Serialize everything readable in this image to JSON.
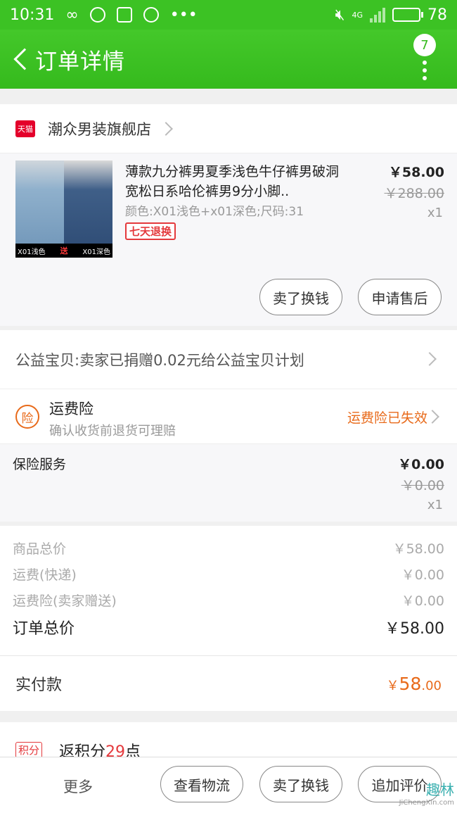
{
  "status_bar": {
    "time": "10:31",
    "network": "4G",
    "battery": "78",
    "battery_level": 0.78
  },
  "header": {
    "title": "订单详情",
    "menu_badge": "7"
  },
  "shop": {
    "badge": "天猫",
    "name": "潮众男装旗舰店"
  },
  "item": {
    "title": "薄款九分裤男夏季浅色牛仔裤男破洞宽松日系哈伦裤男9分小脚..",
    "spec": "颜色:X01浅色+x01深色;尺码:31",
    "tag": "七天退换",
    "price": "￥58.00",
    "original_price": "￥288.00",
    "quantity": "x1",
    "thumb_left_label": "X01浅色",
    "thumb_mid_label": "送",
    "thumb_right_label": "X01深色",
    "sell_button": "卖了换钱",
    "after_sale_button": "申请售后"
  },
  "charity": {
    "text": "公益宝贝:卖家已捐赠0.02元给公益宝贝计划"
  },
  "freight_insurance": {
    "icon_label": "险",
    "title": "运费险",
    "subtitle": "确认收货前退货可理赔",
    "status": "运费险已失效"
  },
  "insurance_service": {
    "name": "保险服务",
    "price": "￥0.00",
    "original_price": "￥0.00",
    "quantity": "x1"
  },
  "summary": {
    "rows": [
      {
        "label": "商品总价",
        "value": "￥58.00"
      },
      {
        "label": "运费(快递)",
        "value": "￥0.00"
      },
      {
        "label": "运费险(卖家赠送)",
        "value": "￥0.00"
      }
    ],
    "total_label": "订单总价",
    "total_value": "￥58.00"
  },
  "paid": {
    "label": "实付款",
    "currency": "￥",
    "integer": "58",
    "decimal": ".00"
  },
  "points": {
    "badge": "积分",
    "text_prefix": "返积分",
    "value": "29",
    "suffix": "点"
  },
  "bottom_bar": {
    "more": "更多",
    "logistics": "查看物流",
    "sell": "卖了换钱",
    "review": "追加评价"
  },
  "watermark": {
    "text": "趣林",
    "url_text": "JiChengXin.com"
  },
  "colors": {
    "brand_green": "#3cc224",
    "accent_orange": "#e86a1a",
    "tmall_red": "#e4002b"
  }
}
